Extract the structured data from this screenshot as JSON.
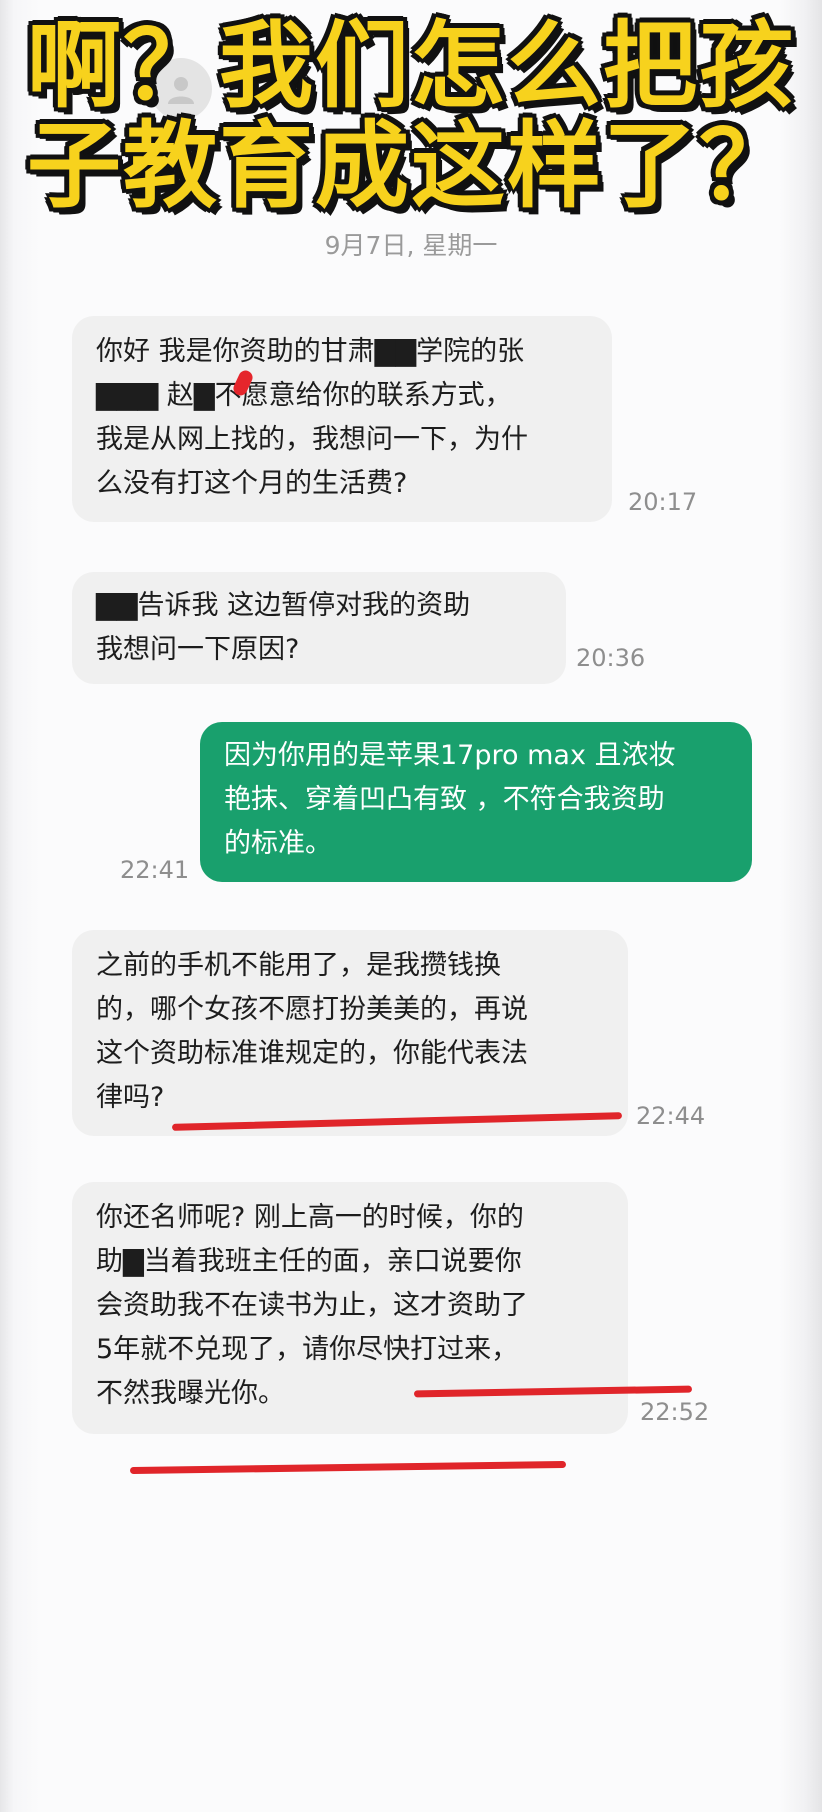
{
  "headline": {
    "line1": "啊？我们怎么把孩",
    "line2": "子教育成这样了？"
  },
  "chat": {
    "date_divider": "9月7日, 星期一",
    "messages": [
      {
        "direction": "incoming",
        "lines": [
          "你好 我是你资助的甘肃▇▇学院的张",
          "▇▇▇ 赵▇不愿意给你的联系方式，",
          "我是从网上找的，我想问一下，为什",
          "么没有打这个月的生活费?"
        ],
        "time": "20:17"
      },
      {
        "direction": "incoming",
        "lines": [
          "▇▇告诉我 这边暂停对我的资助",
          "我想问一下原因?"
        ],
        "time": "20:36"
      },
      {
        "direction": "outgoing",
        "lines": [
          "因为你用的是苹果17pro max 且浓妆",
          "艳抹、穿着凹凸有致 ，不符合我资助",
          "的标准。"
        ],
        "time": "22:41"
      },
      {
        "direction": "incoming",
        "lines": [
          "之前的手机不能用了，是我攒钱换",
          "的，哪个女孩不愿打扮美美的，再说",
          "这个资助标准谁规定的，你能代表法",
          "律吗?"
        ],
        "time": "22:44"
      },
      {
        "direction": "incoming",
        "lines": [
          "你还名师呢? 刚上高一的时候，你的",
          "助▇当着我班主任的面，亲口说要你",
          "会资助我不在读书为止，这才资助了",
          "5年就不兑现了，请你尽快打过来，",
          "不然我曝光你。"
        ],
        "time": "22:52"
      }
    ]
  },
  "colors": {
    "headline_fill": "#f7d21d",
    "outgoing_bubble": "#19a06d",
    "incoming_bubble": "#f0f0f0",
    "annotation_red": "#e0252a"
  },
  "icons": {
    "avatar": "person-avatar-icon"
  }
}
